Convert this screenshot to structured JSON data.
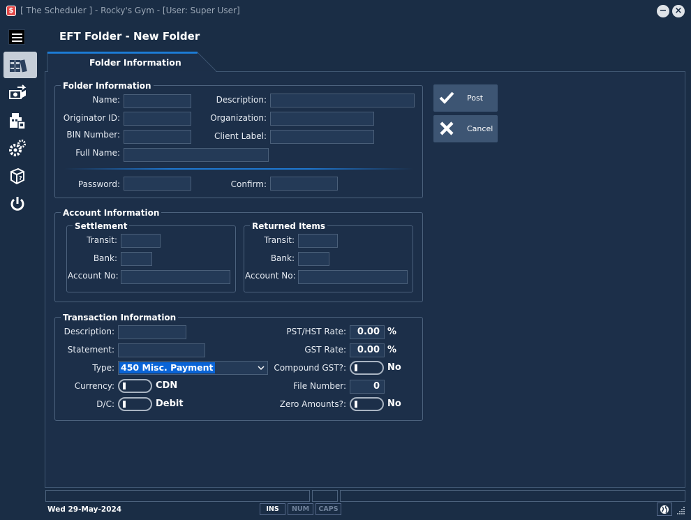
{
  "window": {
    "app_icon_glyph": "$",
    "title": "[ The Scheduler ] - Rocky's Gym - [User: Super User]",
    "minimize_glyph": "−",
    "close_glyph": "×"
  },
  "nav": {
    "items": [
      "menu-icon",
      "folders-icon",
      "money-transfer-icon",
      "register-icon",
      "settings-icon",
      "package-icon",
      "power-icon"
    ]
  },
  "page": {
    "title": "EFT Folder - New Folder",
    "tab_label": "Folder Information"
  },
  "folder_info": {
    "legend": "Folder Information",
    "name_label": "Name:",
    "description_label": "Description:",
    "originator_label": "Originator ID:",
    "organization_label": "Organization:",
    "bin_label": "BIN Number:",
    "client_label": "Client Label:",
    "full_name_label": "Full Name:",
    "password_label": "Password:",
    "confirm_label": "Confirm:"
  },
  "account_info": {
    "legend": "Account Information",
    "settlement": {
      "legend": "Settlement",
      "transit_label": "Transit:",
      "bank_label": "Bank:",
      "account_label": "Account No:"
    },
    "returned": {
      "legend": "Returned Items",
      "transit_label": "Transit:",
      "bank_label": "Bank:",
      "account_label": "Account No:"
    }
  },
  "transaction_info": {
    "legend": "Transaction Information",
    "description_label": "Description:",
    "statement_label": "Statement:",
    "type_label": "Type:",
    "type_value": "450  Misc. Payment",
    "currency_label": "Currency:",
    "currency_value": "CDN",
    "dc_label": "D/C:",
    "dc_value": "Debit",
    "pst_label": "PST/HST Rate:",
    "pst_value": "0.00",
    "pst_unit": "%",
    "gst_label": "GST Rate:",
    "gst_value": "0.00",
    "gst_unit": "%",
    "compound_label": "Compound GST?:",
    "compound_value": "No",
    "file_number_label": "File Number:",
    "file_number_value": "0",
    "zero_label": "Zero Amounts?:",
    "zero_value": "No"
  },
  "buttons": {
    "post_label": "Post",
    "cancel_label": "Cancel"
  },
  "status": {
    "date": "Wed  29-May-2024",
    "ins": "INS",
    "num": "NUM",
    "caps": "CAPS"
  },
  "colors": {
    "background": "#1a2d45",
    "panel": "#1c2f49",
    "field": "#243a57",
    "button": "#3d5573",
    "selection": "#0a64d6"
  }
}
